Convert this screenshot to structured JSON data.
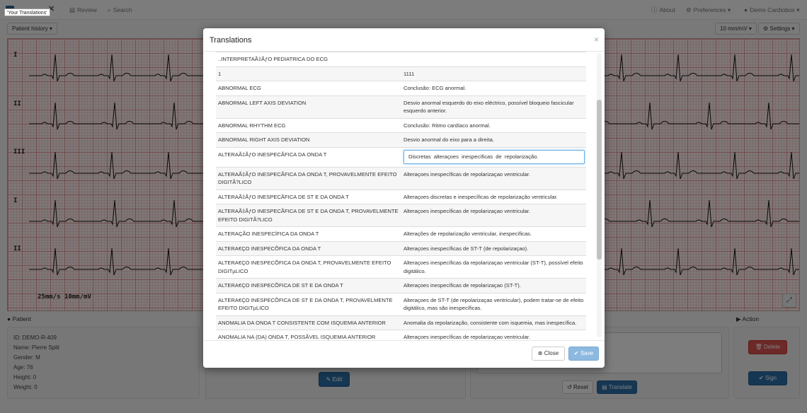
{
  "navbar": {
    "tooltip": "'Your Translations'",
    "review": "Review",
    "search": "Search",
    "about": "About",
    "preferences": "Preferences",
    "user": "Demo Cardiobox"
  },
  "toolbar": {
    "patient_history": "Patient history",
    "zoom": "10 mm/mV",
    "settings": "Settings"
  },
  "ecg": {
    "leads": [
      "I",
      "II",
      "III",
      "I",
      "II"
    ],
    "scale": "25mm/s 10mm/mV"
  },
  "patient": {
    "heading": "Patient",
    "id": "ID: DEMO-R-409",
    "name": "Name: Pierre Split",
    "gender": "Gender: M",
    "age": "Age: 76",
    "height": "Height: 0",
    "weight": "Weight: 0"
  },
  "middle_panel": {
    "edit": "Edit"
  },
  "report_panel": {
    "reset": "Reset",
    "translate": "Translate"
  },
  "action": {
    "heading": "Action",
    "delete": "Delete",
    "sign": "Sign"
  },
  "modal": {
    "title": "Translations",
    "close_symbol": "×",
    "rows": [
      {
        "en": "..INTERPRETAÃ‡ÃƒO PEDIATRICA DO ECG",
        "pt": ""
      },
      {
        "en": "1",
        "pt": "1111"
      },
      {
        "en": "ABNORMAL ECG",
        "pt": "Conclusão: ECG anormal."
      },
      {
        "en": "ABNORMAL LEFT AXIS DEVIATION",
        "pt": "Desvio anormal esquerdo do eixo eléctrico, possível bloqueio fascicular esquerdo anterior."
      },
      {
        "en": "ABNORMAL RHYTHM ECG",
        "pt": "Conclusão: Ritmo cardíaco anormal."
      },
      {
        "en": "ABNORMAL RIGHT AXIS DEVIATION",
        "pt": "Desvio anormal do eixo para a direita."
      },
      {
        "en": "ALTERAÃ‡ÃƒO INESPECÃFICA DA ONDA T",
        "pt": "Discretas  alteraçoes  inespecíficas  de  repolarização.",
        "editing": true
      },
      {
        "en": "ALTERAÃ‡ÃƒO INESPECÃFICA DA ONDA T, PROVAVELMENTE EFEITO DIGITÃ?LICO",
        "pt": "Alteraçoes inespecíficas de repolarizaçao ventricular."
      },
      {
        "en": "ALTERAÃ‡ÃƒO INESPECÃFICA DE ST E DA ONDA T",
        "pt": "Alteraçoes discretas e inespecíficas de repolarização ventricular."
      },
      {
        "en": "ALTERAÃ‡ÃƒO INESPECÃFICA DE ST E DA ONDA T, PROVAVELMENTE EFEITO DIGITÃ?LICO",
        "pt": "Alteraçoes inespecíficas de repolarizaçao ventricular."
      },
      {
        "en": "ALTERAÇÃO INESPECÍFICA DA ONDA T",
        "pt": "Alterações de repolarização ventricular, inespecíficas."
      },
      {
        "en": "ALTERA€ÇO INESPECÕFICA DA ONDA T",
        "pt": "Alteraçoes inespecíficas de ST-T (de repolarizaçao)."
      },
      {
        "en": "ALTERA€ÇO INESPECÕFICA DA ONDA T, PROVAVELMENTE EFEITO DIGITµLICO",
        "pt": "Alteraçoes inespecíficas da repolarizaçao ventricular (ST-T), possível efeito digitálico."
      },
      {
        "en": "ALTERA€ÇO INESPECÕFICA DE ST E DA ONDA T",
        "pt": "Alteraçoes inespecíficas de repolarizaçao (ST-T)."
      },
      {
        "en": "ALTERA€ÇO INESPECÕFICA DE ST E DA ONDA T, PROVAVELMENTE EFEITO DIGITµLICO",
        "pt": "Alteraçoes de ST-T (de repolarizaçao ventricular), podem tratar-se de efeito digitálico, mas são inespecíficas."
      },
      {
        "en": "ANOMALIA DA ONDA T CONSISTENTE COM ISQUEMIA ANTERIOR",
        "pt": "Anomalia da repolarização, consistente com isquemia, mas inespecífica."
      },
      {
        "en": "ANOMALIA NA (DA) ONDA T, POSSÃVEL ISQUEMIA ANTERIOR",
        "pt": "Alteraçoes inespecíficas de repolarizaçao ventricular."
      },
      {
        "en": "ANOMALIA NA (DA) ONDA T, POSSÖVEL ISQUEMIA ANTERIOR",
        "pt": "Anomalia da onda T, inespecífica, considerar possível isquemia"
      }
    ],
    "close_button": "Close",
    "save_button": "Save"
  }
}
